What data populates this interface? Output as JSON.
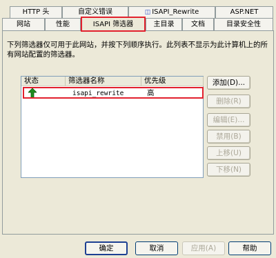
{
  "tabs": {
    "row1": [
      {
        "label": "HTTP 头"
      },
      {
        "label": "自定义错误"
      },
      {
        "label": "ISAPI_Rewrite",
        "icon": "isapi-rewrite-icon"
      },
      {
        "label": "ASP.NET"
      }
    ],
    "row2": [
      {
        "label": "网站"
      },
      {
        "label": "性能"
      },
      {
        "label": "ISAPI 筛选器",
        "active": true
      },
      {
        "label": "主目录"
      },
      {
        "label": "文档"
      },
      {
        "label": "目录安全性"
      }
    ]
  },
  "description": "下列筛选器仅可用于此网站，并按下列顺序执行。此列表不显示为此计算机上的所有网站配置的筛选器。",
  "filters_list": {
    "columns": [
      "状态",
      "筛选器名称",
      "优先级"
    ],
    "rows": [
      {
        "status_icon": "green-up-arrow-icon",
        "name": "isapi_rewrite",
        "priority": "高"
      }
    ]
  },
  "side_buttons": {
    "add": "添加(D)...",
    "remove": "删除(R)",
    "edit": "编辑(E)...",
    "disable": "禁用(B)",
    "move_up": "上移(U)",
    "move_down": "下移(N)"
  },
  "footer": {
    "ok": "确定",
    "cancel": "取消",
    "apply": "应用(A)",
    "help": "帮助"
  },
  "colors": {
    "highlight_border": "#e2202d",
    "status_arrow": "#1e8c1e"
  }
}
